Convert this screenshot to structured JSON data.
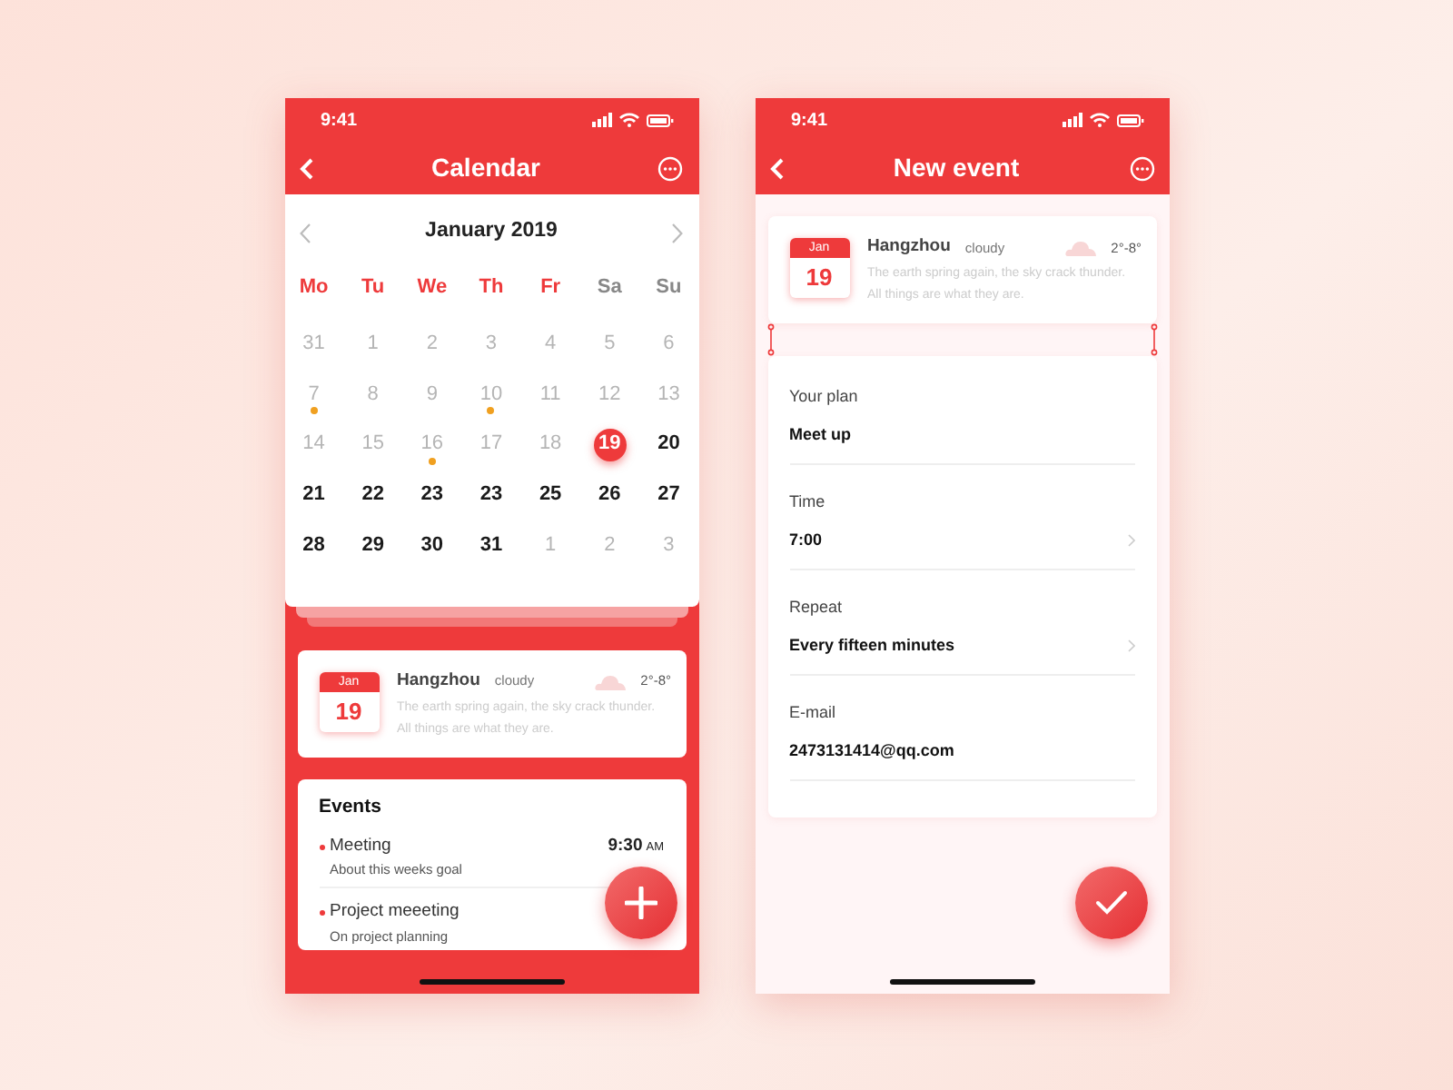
{
  "calendar_screen": {
    "status_time": "9:41",
    "title": "Calendar",
    "calendar": {
      "month": "January  2019",
      "weekdays": [
        {
          "label": "Mo",
          "weekend": false
        },
        {
          "label": "Tu",
          "weekend": false
        },
        {
          "label": "We",
          "weekend": false
        },
        {
          "label": "Th",
          "weekend": false
        },
        {
          "label": "Fr",
          "weekend": false
        },
        {
          "label": "Sa",
          "weekend": true
        },
        {
          "label": "Su",
          "weekend": true
        }
      ],
      "days": [
        {
          "label": "31",
          "dim": true,
          "dot": false,
          "selected": false
        },
        {
          "label": "1",
          "dim": true,
          "dot": false,
          "selected": false
        },
        {
          "label": "2",
          "dim": true,
          "dot": false,
          "selected": false
        },
        {
          "label": "3",
          "dim": true,
          "dot": false,
          "selected": false
        },
        {
          "label": "4",
          "dim": true,
          "dot": false,
          "selected": false
        },
        {
          "label": "5",
          "dim": true,
          "dot": false,
          "selected": false
        },
        {
          "label": "6",
          "dim": true,
          "dot": false,
          "selected": false
        },
        {
          "label": "7",
          "dim": true,
          "dot": true,
          "selected": false
        },
        {
          "label": "8",
          "dim": true,
          "dot": false,
          "selected": false
        },
        {
          "label": "9",
          "dim": true,
          "dot": false,
          "selected": false
        },
        {
          "label": "10",
          "dim": true,
          "dot": true,
          "selected": false
        },
        {
          "label": "11",
          "dim": true,
          "dot": false,
          "selected": false
        },
        {
          "label": "12",
          "dim": true,
          "dot": false,
          "selected": false
        },
        {
          "label": "13",
          "dim": true,
          "dot": false,
          "selected": false
        },
        {
          "label": "14",
          "dim": true,
          "dot": false,
          "selected": false
        },
        {
          "label": "15",
          "dim": true,
          "dot": false,
          "selected": false
        },
        {
          "label": "16",
          "dim": true,
          "dot": true,
          "selected": false
        },
        {
          "label": "17",
          "dim": true,
          "dot": false,
          "selected": false
        },
        {
          "label": "18",
          "dim": true,
          "dot": false,
          "selected": false
        },
        {
          "label": "19",
          "dim": false,
          "dot": false,
          "selected": true
        },
        {
          "label": "20",
          "dim": false,
          "dot": false,
          "selected": false
        },
        {
          "label": "21",
          "dim": false,
          "dot": false,
          "selected": false
        },
        {
          "label": "22",
          "dim": false,
          "dot": false,
          "selected": false
        },
        {
          "label": "23",
          "dim": false,
          "dot": false,
          "selected": false
        },
        {
          "label": "23",
          "dim": false,
          "dot": false,
          "selected": false
        },
        {
          "label": "25",
          "dim": false,
          "dot": false,
          "selected": false
        },
        {
          "label": "26",
          "dim": false,
          "dot": false,
          "selected": false
        },
        {
          "label": "27",
          "dim": false,
          "dot": false,
          "selected": false
        },
        {
          "label": "28",
          "dim": false,
          "dot": false,
          "selected": false
        },
        {
          "label": "29",
          "dim": false,
          "dot": false,
          "selected": false
        },
        {
          "label": "30",
          "dim": false,
          "dot": false,
          "selected": false
        },
        {
          "label": "31",
          "dim": false,
          "dot": false,
          "selected": false
        },
        {
          "label": "1",
          "dim": true,
          "dot": false,
          "selected": false
        },
        {
          "label": "2",
          "dim": true,
          "dot": false,
          "selected": false
        },
        {
          "label": "3",
          "dim": true,
          "dot": false,
          "selected": false
        }
      ]
    },
    "weather": {
      "month": "Jan",
      "day": "19",
      "city": "Hangzhou",
      "condition": "cloudy",
      "temperature": "2°-8°",
      "text": "The earth spring again, the sky crack thunder. All things are what they are."
    },
    "events": {
      "title": "Events",
      "items": [
        {
          "title": "Meeting",
          "subtitle": "About this weeks goal",
          "time": "9:30",
          "meridiem": "AM"
        },
        {
          "title": "Project meeeting",
          "subtitle": "On project planning"
        }
      ]
    }
  },
  "new_event_screen": {
    "status_time": "9:41",
    "title": "New event",
    "weather": {
      "month": "Jan",
      "day": "19",
      "city": "Hangzhou",
      "condition": "cloudy",
      "temperature": "2°-8°",
      "text": "The earth spring again, the sky crack thunder. All things are what they are."
    },
    "fields": [
      {
        "label": "Your plan",
        "value": "Meet up",
        "chevron": false
      },
      {
        "label": "Time",
        "value": "7:00",
        "chevron": true
      },
      {
        "label": "Repeat",
        "value": "Every fifteen minutes",
        "chevron": true
      },
      {
        "label": "E-mail",
        "value": "2473131414@qq.com",
        "chevron": false
      }
    ]
  }
}
